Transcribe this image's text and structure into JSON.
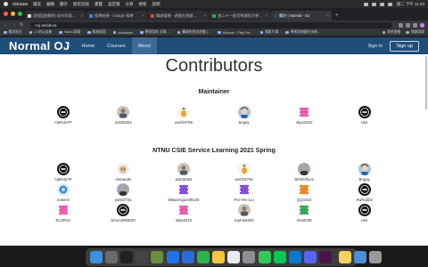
{
  "menubar": {
    "app": "Chrome",
    "items": [
      "檔案",
      "編輯",
      "顯示",
      "歷史記錄",
      "書籤",
      "設定檔",
      "分頁",
      "視窗",
      "說明"
    ],
    "clock": "週二 下午 11:20"
  },
  "tabs": [
    {
      "title": "[遊戲][遊戲射] 成年同樂觀察院 ...",
      "color": "#e8eaed"
    },
    {
      "title": "搜尋結果 - Google 搜尋",
      "color": "#4285f4"
    },
    {
      "title": "職缺搜尋 - 遊戲社遊戲 ...",
      "color": "#ea4335"
    },
    {
      "title": "週二十一區哲學課程文學遊戲",
      "color": "#34a853"
    },
    {
      "title": "關於 | Normal - OJ",
      "color": "#1f4e79",
      "active": true
    }
  ],
  "address": {
    "url": "noj.tw/about"
  },
  "bookmarks": {
    "items": [
      "應用程式",
      "JJ 的公告集",
      "Yahoo奇摩",
      "服務頁面",
      "socialdots",
      "學習園地 文章 ...",
      "購買免費包遊戲 (...",
      "Mikunie - Play Fre...",
      "電影片單",
      "學術與遊戲社技術..."
    ],
    "right": [
      "其他書籤",
      "閱讀清單"
    ]
  },
  "site": {
    "brand": "Normal OJ",
    "nav": [
      "Home",
      "Courses",
      "About"
    ],
    "active_nav": "About",
    "signin": "Sign in",
    "signup": "Sign up"
  },
  "page": {
    "title": "Contributors",
    "sections": [
      {
        "title": "Maintainer",
        "people": [
          {
            "name": "AlaRduTP",
            "avatar": "logo-dark"
          },
          {
            "name": "as535364",
            "avatar": "photo"
          },
          {
            "name": "asef18766",
            "avatar": "pineapple"
          },
          {
            "name": "Bogay",
            "avatar": "anime"
          },
          {
            "name": "skps2010",
            "avatar": "pink-pixel"
          },
          {
            "name": "Uier",
            "avatar": "logo-dark"
          }
        ]
      },
      {
        "title": "NTNU CSIE Service Learning 2021 Spring",
        "people": [
          {
            "name": "AlaRduTP",
            "avatar": "logo-dark"
          },
          {
            "name": "Alanaade",
            "avatar": "dog"
          },
          {
            "name": "as535364",
            "avatar": "photo"
          },
          {
            "name": "asef18766",
            "avatar": "pineapple"
          },
          {
            "name": "BirkhoffLee",
            "avatar": "person"
          },
          {
            "name": "Bogay",
            "avatar": "anime"
          },
          {
            "name": "eokeeli",
            "avatar": "blue"
          },
          {
            "name": "jw910731",
            "avatar": "person"
          },
          {
            "name": "littlepenguin89106",
            "avatar": "purple-pixel"
          },
          {
            "name": "Pei-Yen-Liu",
            "avatar": "purple-pixel"
          },
          {
            "name": "QQ1010",
            "avatar": "orange-pixel"
          },
          {
            "name": "RuRobbit",
            "avatar": "logo-dark"
          },
          {
            "name": "RUJRSJ",
            "avatar": "pink-pixel"
          },
          {
            "name": "simon0955687",
            "avatar": "logo-dark"
          },
          {
            "name": "skps2010",
            "avatar": "pink-pixel"
          },
          {
            "name": "sophie6909",
            "avatar": "photo"
          },
          {
            "name": "toto6038",
            "avatar": "green-pixel"
          },
          {
            "name": "Uier",
            "avatar": "logo-dark"
          }
        ]
      }
    ]
  },
  "dock": [
    {
      "icon": "finder-icon",
      "color": "#3d8fe0"
    },
    {
      "icon": "launchpad-icon",
      "color": "#6a6a6a"
    },
    {
      "icon": "terminal-icon",
      "color": "#222222"
    },
    {
      "icon": "app-icon",
      "color": "#444444"
    },
    {
      "icon": "minecraft-icon",
      "color": "#6b8e3d"
    },
    {
      "icon": "xcode-icon",
      "color": "#1c74e8"
    },
    {
      "icon": "keynote-icon",
      "color": "#2d6bd8"
    },
    {
      "icon": "numbers-icon",
      "color": "#2fb24c"
    },
    {
      "icon": "photos-icon",
      "color": "#f5c542"
    },
    {
      "icon": "chrome-icon",
      "color": "#e9ecef"
    },
    {
      "icon": "settings-icon",
      "color": "#8e8e93"
    },
    {
      "icon": "messages-icon",
      "color": "#34c759"
    },
    {
      "icon": "line-icon",
      "color": "#06c755"
    },
    {
      "icon": "vscode-icon",
      "color": "#0b78d0"
    },
    {
      "icon": "discord-icon",
      "color": "#5865f2"
    },
    {
      "icon": "slack-icon",
      "color": "#4a154b"
    },
    {
      "icon": "notes-icon",
      "color": "#f3d35b"
    },
    {
      "icon": "downloads-icon",
      "color": "#4a90d9"
    },
    {
      "icon": "trash-icon",
      "color": "#9a9a9a"
    }
  ]
}
